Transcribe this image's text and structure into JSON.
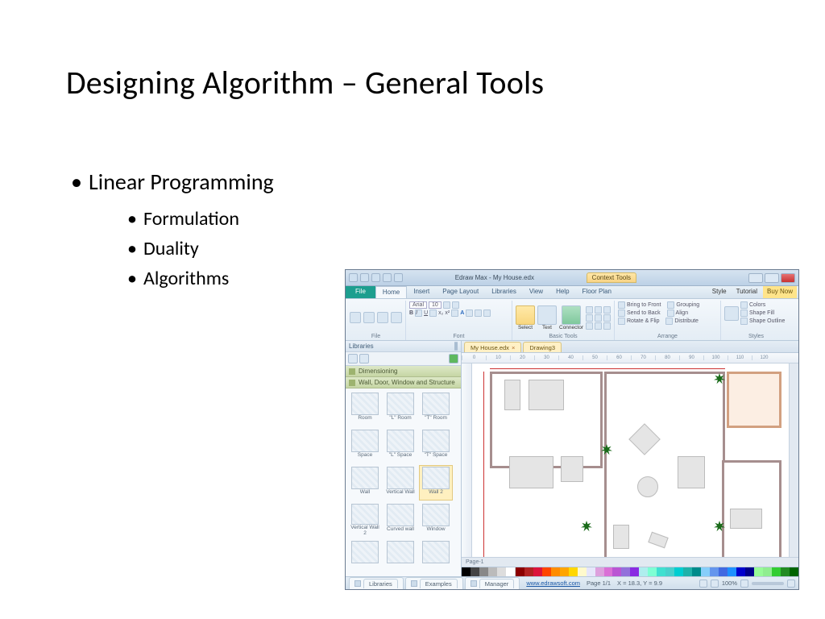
{
  "slide": {
    "title": "Designing Algorithm – General Tools",
    "bullets": {
      "main": "Linear Programming",
      "sub": [
        "Formulation",
        "Duality",
        "Algorithms"
      ]
    }
  },
  "app": {
    "window_title": "Edraw Max - My House.edx",
    "context_tab": "Context Tools",
    "file_tab": "File",
    "tabs": [
      "Home",
      "Insert",
      "Page Layout",
      "Libraries",
      "View",
      "Help",
      "Floor Plan"
    ],
    "right_links": {
      "style": "Style",
      "tutorial": "Tutorial",
      "buy": "Buy Now"
    },
    "ribbon": {
      "file": "File",
      "font_group": "Font",
      "font_name": "Arial",
      "font_size": "10",
      "basic_tools": "Basic Tools",
      "select": "Select",
      "text": "Text",
      "connector": "Connector",
      "arrange": "Arrange",
      "bring_front": "Bring to Front",
      "send_back": "Send to Back",
      "rotate_flip": "Rotate & Flip",
      "grouping": "Grouping",
      "align": "Align",
      "distribute": "Distribute",
      "styles": "Styles",
      "colors": "Colors",
      "shape_fill": "Shape Fill",
      "shape_outline": "Shape Outline"
    },
    "library": {
      "panel_title": "Libraries",
      "cat1": "Dimensioning",
      "cat2": "Wall, Door, Window and Structure",
      "shapes": [
        "Room",
        "\"L\" Room",
        "\"T\" Room",
        "Space",
        "\"L\" Space",
        "\"T\" Space",
        "Wall",
        "Vertical Wall",
        "Wall 2",
        "Vertical Wall 2",
        "Curved wall",
        "Window",
        "",
        "",
        ""
      ]
    },
    "doc_tabs": {
      "tab1": "My House.edx",
      "tab2": "Drawing3"
    },
    "ruler_marks": [
      "0",
      "10",
      "20",
      "30",
      "40",
      "50",
      "60",
      "70",
      "80",
      "90",
      "100",
      "110",
      "120"
    ],
    "page_label": "Page-1",
    "status": {
      "tabs": [
        "Libraries",
        "Examples",
        "Manager"
      ],
      "url": "www.edrawsoft.com",
      "page": "Page 1/1",
      "coords": "X = 18.3, Y = 9.9",
      "zoom": "100%"
    }
  }
}
